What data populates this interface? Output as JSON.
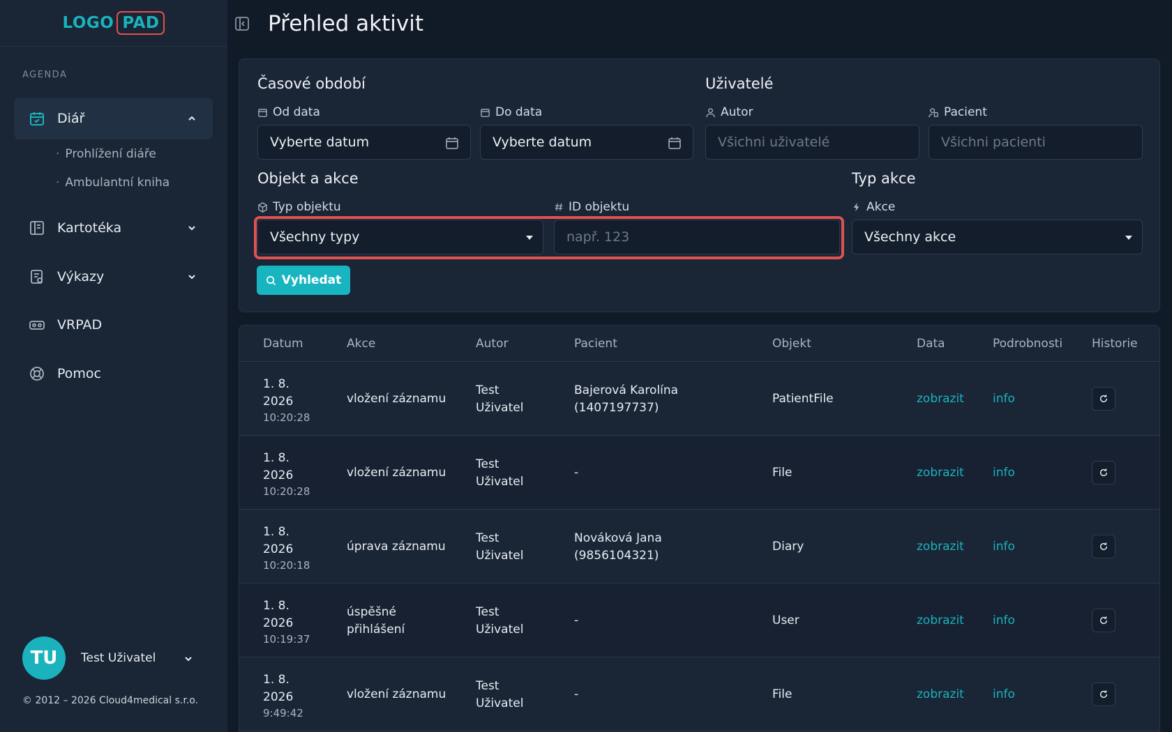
{
  "logo": {
    "part1": "LOGO",
    "part2": "PAD"
  },
  "sidebar": {
    "section": "AGENDA",
    "items": [
      {
        "label": "Diář",
        "icon": "calendar-check-icon"
      },
      {
        "label": "Kartotéka",
        "icon": "book-icon"
      },
      {
        "label": "Výkazy",
        "icon": "report-icon"
      },
      {
        "label": "VRPAD",
        "icon": "vr-headset-icon"
      },
      {
        "label": "Pomoc",
        "icon": "lifebuoy-icon"
      }
    ],
    "subitems": [
      "Prohlížení diáře",
      "Ambulantní kniha"
    ]
  },
  "user": {
    "initials": "TU",
    "name": "Test Uživatel"
  },
  "copyright": "© 2012 – 2026 Cloud4medical s.r.o.",
  "header": {
    "title": "Přehled aktivit"
  },
  "filters": {
    "period_title": "Časové období",
    "from_label": "Od data",
    "from_value": "Vyberte datum",
    "to_label": "Do data",
    "to_value": "Vyberte datum",
    "users_title": "Uživatelé",
    "author_label": "Autor",
    "author_placeholder": "Všichni uživatelé",
    "patient_label": "Pacient",
    "patient_placeholder": "Všichni pacienti",
    "object_title": "Objekt a akce",
    "type_label": "Typ objektu",
    "type_value": "Všechny typy",
    "id_label": "ID objektu",
    "id_placeholder": "např. 123",
    "action_title": "Typ akce",
    "action_label": "Akce",
    "action_value": "Všechny akce",
    "search_label": "Vyhledat"
  },
  "table": {
    "headers": [
      "Datum",
      "Akce",
      "Autor",
      "Pacient",
      "Objekt",
      "Data",
      "Podrobnosti",
      "Historie"
    ],
    "rows": [
      {
        "date1": "1. 8.",
        "date2": "2026",
        "time": "10:20:28",
        "action1": "vložení záznamu",
        "action2": "",
        "author1": "Test",
        "author2": "Uživatel",
        "patient1": "Bajerová Karolína",
        "patient2": "(1407197737)",
        "object": "PatientFile",
        "data": "zobrazit",
        "details": "info"
      },
      {
        "date1": "1. 8.",
        "date2": "2026",
        "time": "10:20:28",
        "action1": "vložení záznamu",
        "action2": "",
        "author1": "Test",
        "author2": "Uživatel",
        "patient1": "-",
        "patient2": "",
        "object": "File",
        "data": "zobrazit",
        "details": "info"
      },
      {
        "date1": "1. 8.",
        "date2": "2026",
        "time": "10:20:18",
        "action1": "úprava záznamu",
        "action2": "",
        "author1": "Test",
        "author2": "Uživatel",
        "patient1": "Nováková Jana",
        "patient2": "(9856104321)",
        "object": "Diary",
        "data": "zobrazit",
        "details": "info"
      },
      {
        "date1": "1. 8.",
        "date2": "2026",
        "time": "10:19:37",
        "action1": "úspěšné",
        "action2": "přihlášení",
        "author1": "Test",
        "author2": "Uživatel",
        "patient1": "-",
        "patient2": "",
        "object": "User",
        "data": "zobrazit",
        "details": "info"
      },
      {
        "date1": "1. 8.",
        "date2": "2026",
        "time": "9:49:42",
        "action1": "vložení záznamu",
        "action2": "",
        "author1": "Test",
        "author2": "Uživatel",
        "patient1": "-",
        "patient2": "",
        "object": "File",
        "data": "zobrazit",
        "details": "info"
      }
    ]
  },
  "colors": {
    "accent": "#1ab3bd",
    "highlight": "#e0524f",
    "background": "#111a27",
    "sidebar": "#1a2535"
  }
}
